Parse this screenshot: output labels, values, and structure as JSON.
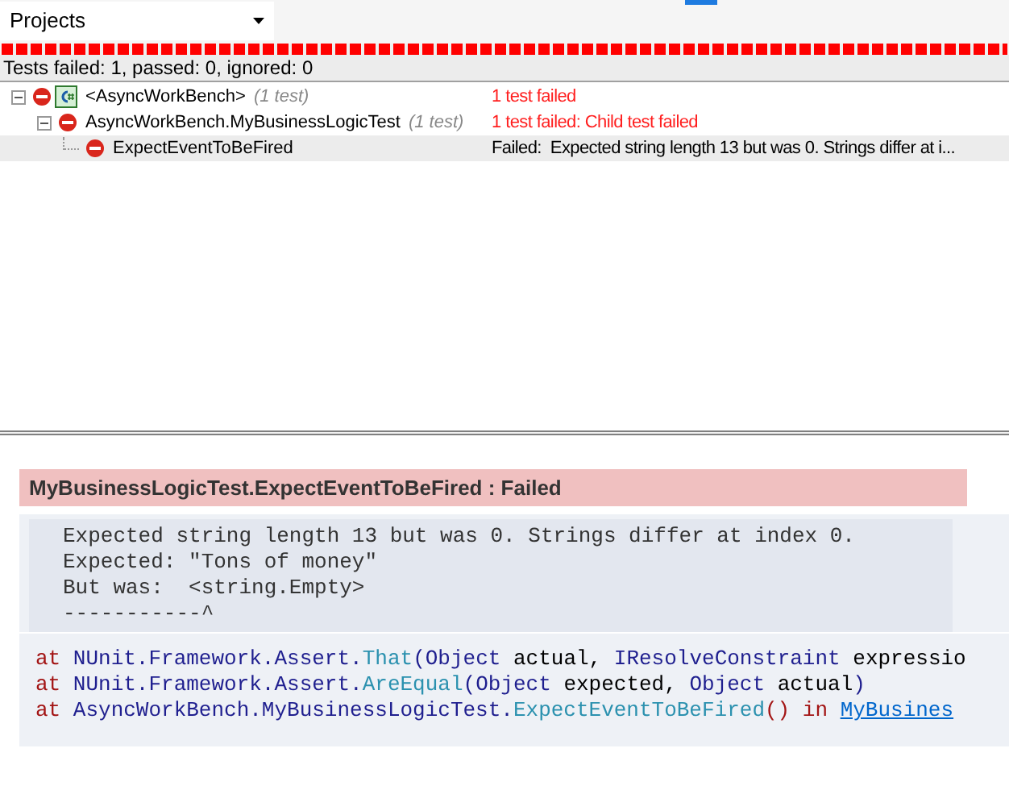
{
  "project_selector": {
    "value": "Projects"
  },
  "progress": {
    "level": 1
  },
  "summary": "Tests failed: 1, passed: 0, ignored: 0",
  "tree": [
    {
      "name": "<AsyncWorkBench>",
      "count": "(1 test)",
      "project_icon": true,
      "expanded": true,
      "result": "1 test failed",
      "color": "#ff1f1f",
      "selected": false,
      "children": [
        {
          "name": "AsyncWorkBench.MyBusinessLogicTest",
          "count": "(1 test)",
          "project_icon": false,
          "expanded": true,
          "result": "1 test failed: Child test failed",
          "color": "#ff1f1f",
          "selected": false,
          "children": [
            {
              "name": "ExpectEventToBeFired",
              "project_icon": false,
              "result": "Failed:  Expected string length 13 but was 0. Strings differ at i...",
              "color": "#000000",
              "selected": true
            }
          ]
        }
      ]
    }
  ],
  "details": {
    "title": "MyBusinessLogicTest.ExpectEventToBeFired : Failed",
    "message": [
      "Expected string length 13 but was 0. Strings differ at index 0.",
      "Expected: \"Tons of money\"",
      "But was:  <string.Empty>",
      "-----------^"
    ],
    "stack_trace": [
      [
        {
          "kind": "keyword",
          "text": "at"
        },
        {
          "kind": "type",
          "text": " NUnit.Framework.Assert."
        },
        {
          "kind": "method",
          "text": "That"
        },
        {
          "kind": "type",
          "text": "(Object "
        },
        {
          "kind": "plain",
          "text": "actual, "
        },
        {
          "kind": "type",
          "text": "IResolveConstraint "
        },
        {
          "kind": "plain",
          "text": "expressio"
        }
      ],
      [
        {
          "kind": "keyword",
          "text": "at"
        },
        {
          "kind": "type",
          "text": " NUnit.Framework.Assert."
        },
        {
          "kind": "method",
          "text": "AreEqual"
        },
        {
          "kind": "type",
          "text": "(Object "
        },
        {
          "kind": "plain",
          "text": "expected, "
        },
        {
          "kind": "type",
          "text": "Object "
        },
        {
          "kind": "plain",
          "text": "actual"
        },
        {
          "kind": "type",
          "text": ")"
        }
      ],
      [
        {
          "kind": "keyword",
          "text": "at"
        },
        {
          "kind": "type",
          "text": " AsyncWorkBench.MyBusinessLogicTest."
        },
        {
          "kind": "method",
          "text": "ExpectEventToBeFired"
        },
        {
          "kind": "keyword",
          "text": "() in "
        },
        {
          "kind": "link",
          "text": "MyBusines"
        }
      ]
    ]
  }
}
